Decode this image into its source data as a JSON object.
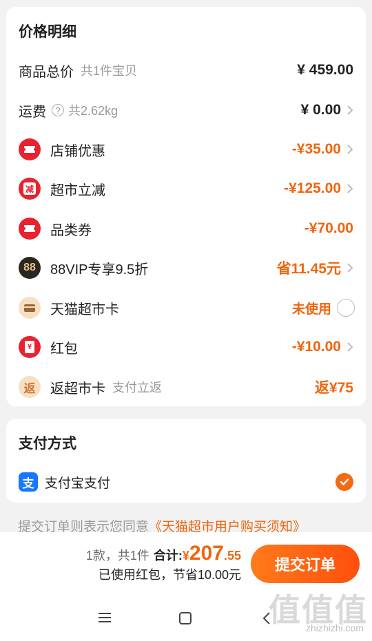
{
  "price_detail": {
    "title": "价格明细",
    "total": {
      "label": "商品总价",
      "sub": "共1件宝贝",
      "amount": "¥ 459.00"
    },
    "shipping": {
      "label": "运费",
      "help_icon": "?",
      "sub": "共2.62kg",
      "amount": "¥ 0.00"
    },
    "shop_discount": {
      "label": "店铺优惠",
      "amount": "-¥35.00"
    },
    "supermarket_cut": {
      "label": "超市立减",
      "icon_text": "减",
      "amount": "-¥125.00"
    },
    "category_coupon": {
      "label": "品类券",
      "amount": "-¥70.00"
    },
    "vip": {
      "label": "88VIP专享9.5折",
      "icon_text": "88",
      "amount": "省11.45元"
    },
    "tmall_card": {
      "label": "天猫超市卡",
      "amount": "未使用"
    },
    "red_packet": {
      "label": "红包",
      "icon_text": "¥",
      "amount": "-¥10.00"
    },
    "rebate_card": {
      "label": "返超市卡",
      "icon_text": "返",
      "sub": "支付立返",
      "amount": "返¥75"
    }
  },
  "payment": {
    "title": "支付方式",
    "alipay": {
      "icon_text": "支",
      "label": "支付宝支付"
    }
  },
  "agreement": {
    "text": "提交订单则表示您同意",
    "link": "《天猫超市用户购买须知》"
  },
  "footer": {
    "count": "1款，共1件",
    "total_label": "合计:",
    "currency": "¥",
    "total_int": "207",
    "total_dec": ".55",
    "saved_note": "已使用红包，节省10.00元",
    "submit_label": "提交订单"
  },
  "watermark": {
    "text": "值值值",
    "sub": "zhizhizhi.com"
  },
  "colors": {
    "accent": "#f0650e",
    "red_icon": "#e8222f",
    "vip_icon": "#2a2620",
    "card_icon": "#f7dfc2"
  }
}
